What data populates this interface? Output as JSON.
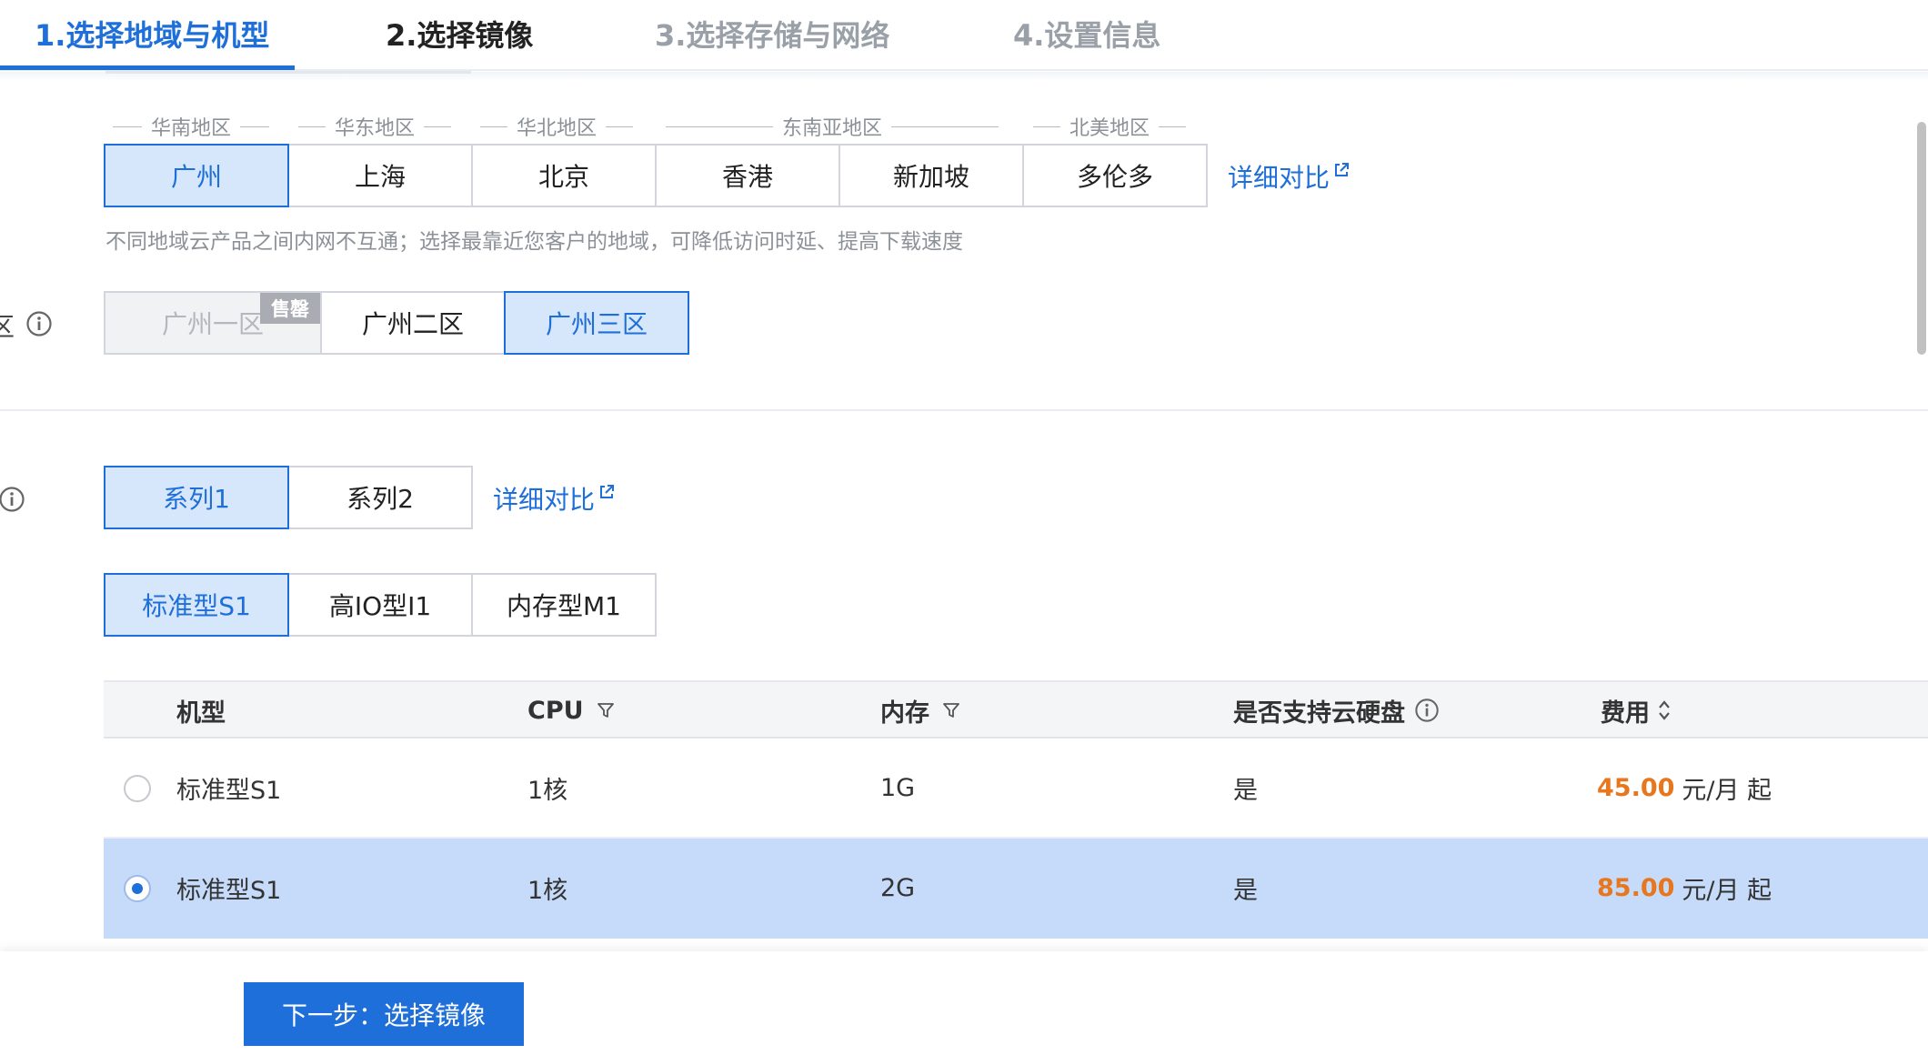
{
  "steps": [
    {
      "label": "1.选择地域与机型",
      "state": "active"
    },
    {
      "label": "2.选择镜像",
      "state": "done"
    },
    {
      "label": "3.选择存储与网络",
      "state": "pending"
    },
    {
      "label": "4.设置信息",
      "state": "pending"
    }
  ],
  "region": {
    "groups": [
      "华南地区",
      "华东地区",
      "华北地区",
      "东南亚地区",
      "北美地区"
    ],
    "options": [
      "广州",
      "上海",
      "北京",
      "香港",
      "新加坡",
      "多伦多"
    ],
    "selected": "广州",
    "compare_link": "详细对比",
    "hint": "不同地域云产品之间内网不互通；选择最靠近您客户的地域，可降低访问时延、提高下载速度"
  },
  "zone": {
    "label_fragment": "区",
    "options": [
      "广州一区",
      "广州二区",
      "广州三区"
    ],
    "selected": "广州三区",
    "sold_out_badge": "售罄"
  },
  "series": {
    "options": [
      "系列1",
      "系列2"
    ],
    "selected": "系列1",
    "compare_link": "详细对比"
  },
  "instance_family": {
    "options": [
      "标准型S1",
      "高IO型I1",
      "内存型M1"
    ],
    "selected": "标准型S1"
  },
  "table": {
    "headers": {
      "model": "机型",
      "cpu": "CPU",
      "memory": "内存",
      "cloud_disk": "是否支持云硬盘",
      "fee": "费用"
    },
    "rows": [
      {
        "model": "标准型S1",
        "cpu": "1核",
        "memory": "1G",
        "cloud_disk": "是",
        "price": "45.00",
        "unit": "元/月 起",
        "selected": false
      },
      {
        "model": "标准型S1",
        "cpu": "1核",
        "memory": "2G",
        "cloud_disk": "是",
        "price": "85.00",
        "unit": "元/月 起",
        "selected": true
      }
    ]
  },
  "footer": {
    "next_button": "下一步：选择镜像"
  },
  "colors": {
    "accent": "#1e6fd9",
    "selected_bg": "#d6e6fb",
    "price": "#e8761d"
  }
}
